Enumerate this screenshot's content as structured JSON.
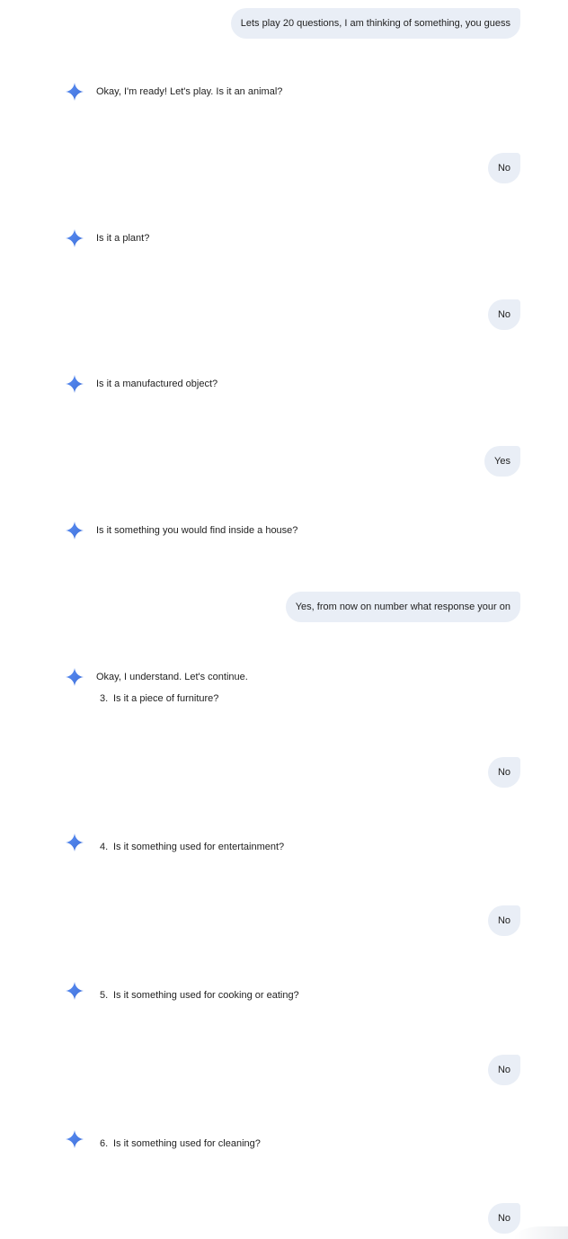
{
  "messages": {
    "u1": "Lets play 20 questions, I am thinking of something, you guess",
    "m1": "Okay, I'm ready!  Let's play.  Is it an animal?",
    "u2": "No",
    "m2": "Is it a plant?",
    "u3": "No",
    "m3": "Is it a manufactured object?",
    "u4": "Yes",
    "m4": "Is it something you would find inside a house?",
    "u5": "Yes, from now on number what response your on",
    "m5_intro": "Okay, I understand.  Let's continue.",
    "m5_num": "3.",
    "m5_item": "Is it a piece of furniture?",
    "u6": "No",
    "m6_num": "4.",
    "m6_item": "Is it something used for entertainment?",
    "u7": "No",
    "m7_num": "5.",
    "m7_item": "Is it something used for cooking or eating?",
    "u8": "No",
    "m8_num": "6.",
    "m8_item": "Is it something used for cleaning?",
    "u9": "No"
  },
  "icons": {
    "model_avatar": "gemini-sparkle-icon"
  },
  "colors": {
    "user_bubble": "#e9eef6",
    "sparkle": "#4f86ec"
  }
}
